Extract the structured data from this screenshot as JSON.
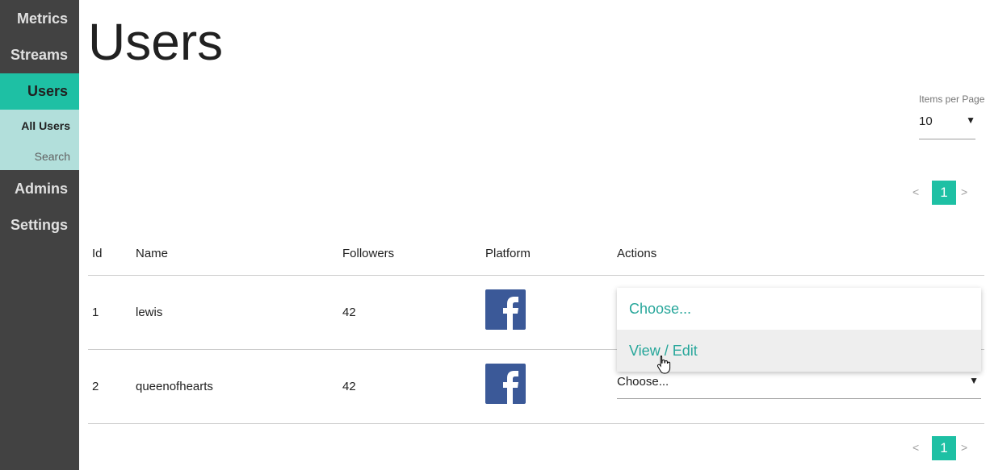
{
  "sidebar": {
    "items": [
      {
        "label": "Metrics"
      },
      {
        "label": "Streams"
      },
      {
        "label": "Users"
      },
      {
        "label": "Admins"
      },
      {
        "label": "Settings"
      }
    ],
    "subitems": [
      {
        "label": "All Users"
      },
      {
        "label": "Search"
      }
    ]
  },
  "page": {
    "title": "Users"
  },
  "items_per_page": {
    "label": "Items per Page",
    "value": "10"
  },
  "pagination": {
    "prev": "<",
    "page": "1",
    "next": ">"
  },
  "table": {
    "headers": [
      "Id",
      "Name",
      "Followers",
      "Platform",
      "Actions"
    ],
    "rows": [
      {
        "id": "1",
        "name": "lewis",
        "followers": "42",
        "platform": "facebook-icon"
      },
      {
        "id": "2",
        "name": "queenofhearts",
        "followers": "42",
        "platform": "facebook-icon",
        "action_value": "Choose..."
      }
    ]
  },
  "actions_dropdown": {
    "options": [
      "Choose...",
      "View / Edit"
    ],
    "highlighted": "View / Edit"
  },
  "colors": {
    "accent": "#1ec0a4",
    "sidebar": "#424242",
    "subnav": "#b2dfdb",
    "facebook": "#3b5998",
    "link": "#26a69a"
  }
}
